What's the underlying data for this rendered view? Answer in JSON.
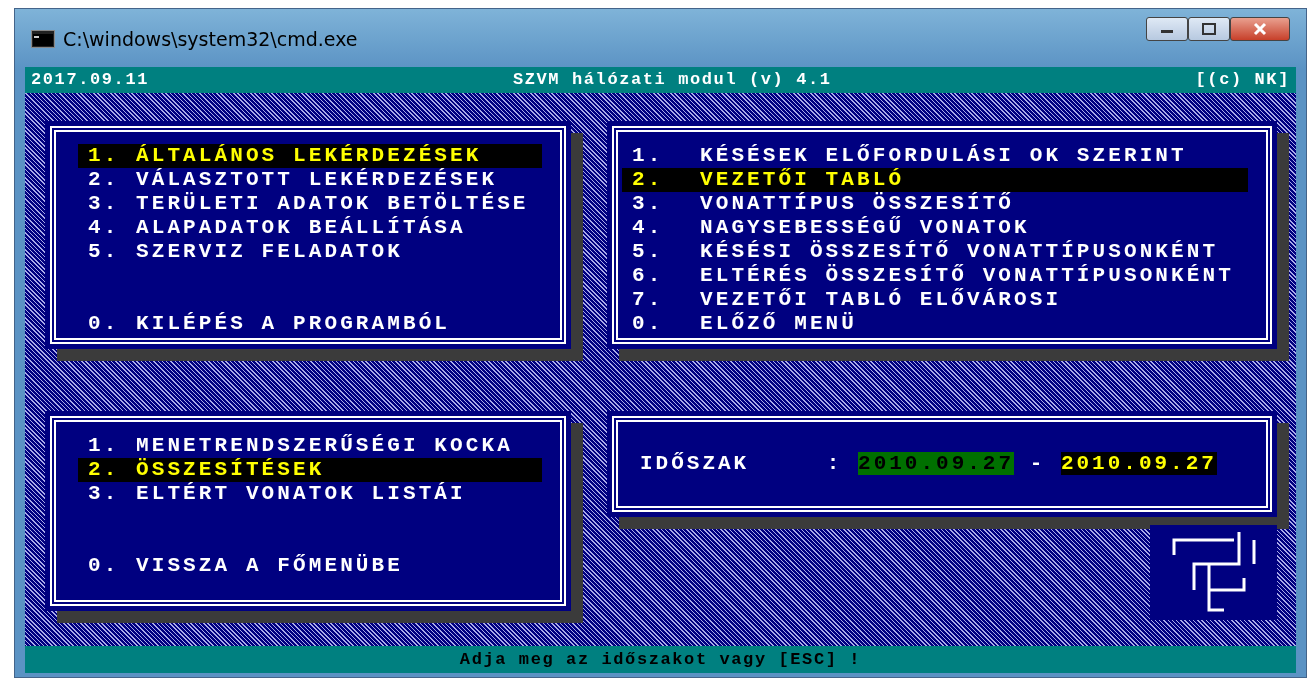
{
  "window": {
    "title": "C:\\windows\\system32\\cmd.exe"
  },
  "header": {
    "date": "2017.09.11",
    "title": "SZVM hálózati modul (v) 4.1",
    "copyright": "[(c) NK]"
  },
  "main_menu": {
    "items": [
      {
        "number": "1.",
        "label": "ÁLTALÁNOS LEKÉRDEZÉSEK",
        "selected": true
      },
      {
        "number": "2.",
        "label": "VÁLASZTOTT LEKÉRDEZÉSEK",
        "selected": false
      },
      {
        "number": "3.",
        "label": "TERÜLETI ADATOK BETÖLTÉSE",
        "selected": false
      },
      {
        "number": "4.",
        "label": "ALAPADATOK BEÁLLÍTÁSA",
        "selected": false
      },
      {
        "number": "5.",
        "label": "SZERVIZ FELADATOK",
        "selected": false
      }
    ],
    "exit": {
      "number": "0.",
      "label": "KILÉPÉS A PROGRAMBÓL",
      "selected": false
    }
  },
  "report_menu": {
    "items": [
      {
        "number": "1.",
        "label": "KÉSÉSEK ELŐFORDULÁSI OK SZERINT",
        "selected": false
      },
      {
        "number": "2.",
        "label": "VEZETŐI TABLÓ",
        "selected": true
      },
      {
        "number": "3.",
        "label": "VONATTÍPUS ÖSSZESÍTŐ",
        "selected": false
      },
      {
        "number": "4.",
        "label": "NAGYSEBESSÉGŰ VONATOK",
        "selected": false
      },
      {
        "number": "5.",
        "label": "KÉSÉSI ÖSSZESÍTŐ VONATTÍPUSONKÉNT",
        "selected": false
      },
      {
        "number": "6.",
        "label": "ELTÉRÉS ÖSSZESÍTŐ VONATTÍPUSONKÉNT",
        "selected": false
      },
      {
        "number": "7.",
        "label": "VEZETŐI TABLÓ ELŐVÁROSI",
        "selected": false
      },
      {
        "number": "0.",
        "label": "ELŐZŐ MENÜ",
        "selected": false
      }
    ]
  },
  "sub_menu": {
    "items": [
      {
        "number": "1.",
        "label": "MENETRENDSZERŰSÉGI KOCKA",
        "selected": false
      },
      {
        "number": "2.",
        "label": "ÖSSZESÍTÉSEK",
        "selected": true
      },
      {
        "number": "3.",
        "label": "ELTÉRT VONATOK LISTÁI",
        "selected": false
      }
    ],
    "exit": {
      "number": "0.",
      "label": "VISSZA A FŐMENÜBE",
      "selected": false
    }
  },
  "period": {
    "label": "IDŐSZAK",
    "separator": ":",
    "from": {
      "value": "2010.09.27",
      "editing": true
    },
    "dash": "-",
    "to": {
      "value": "2010.09.27",
      "editing": false
    }
  },
  "status_bar": "Adja meg az időszakot vagy [ESC] !"
}
